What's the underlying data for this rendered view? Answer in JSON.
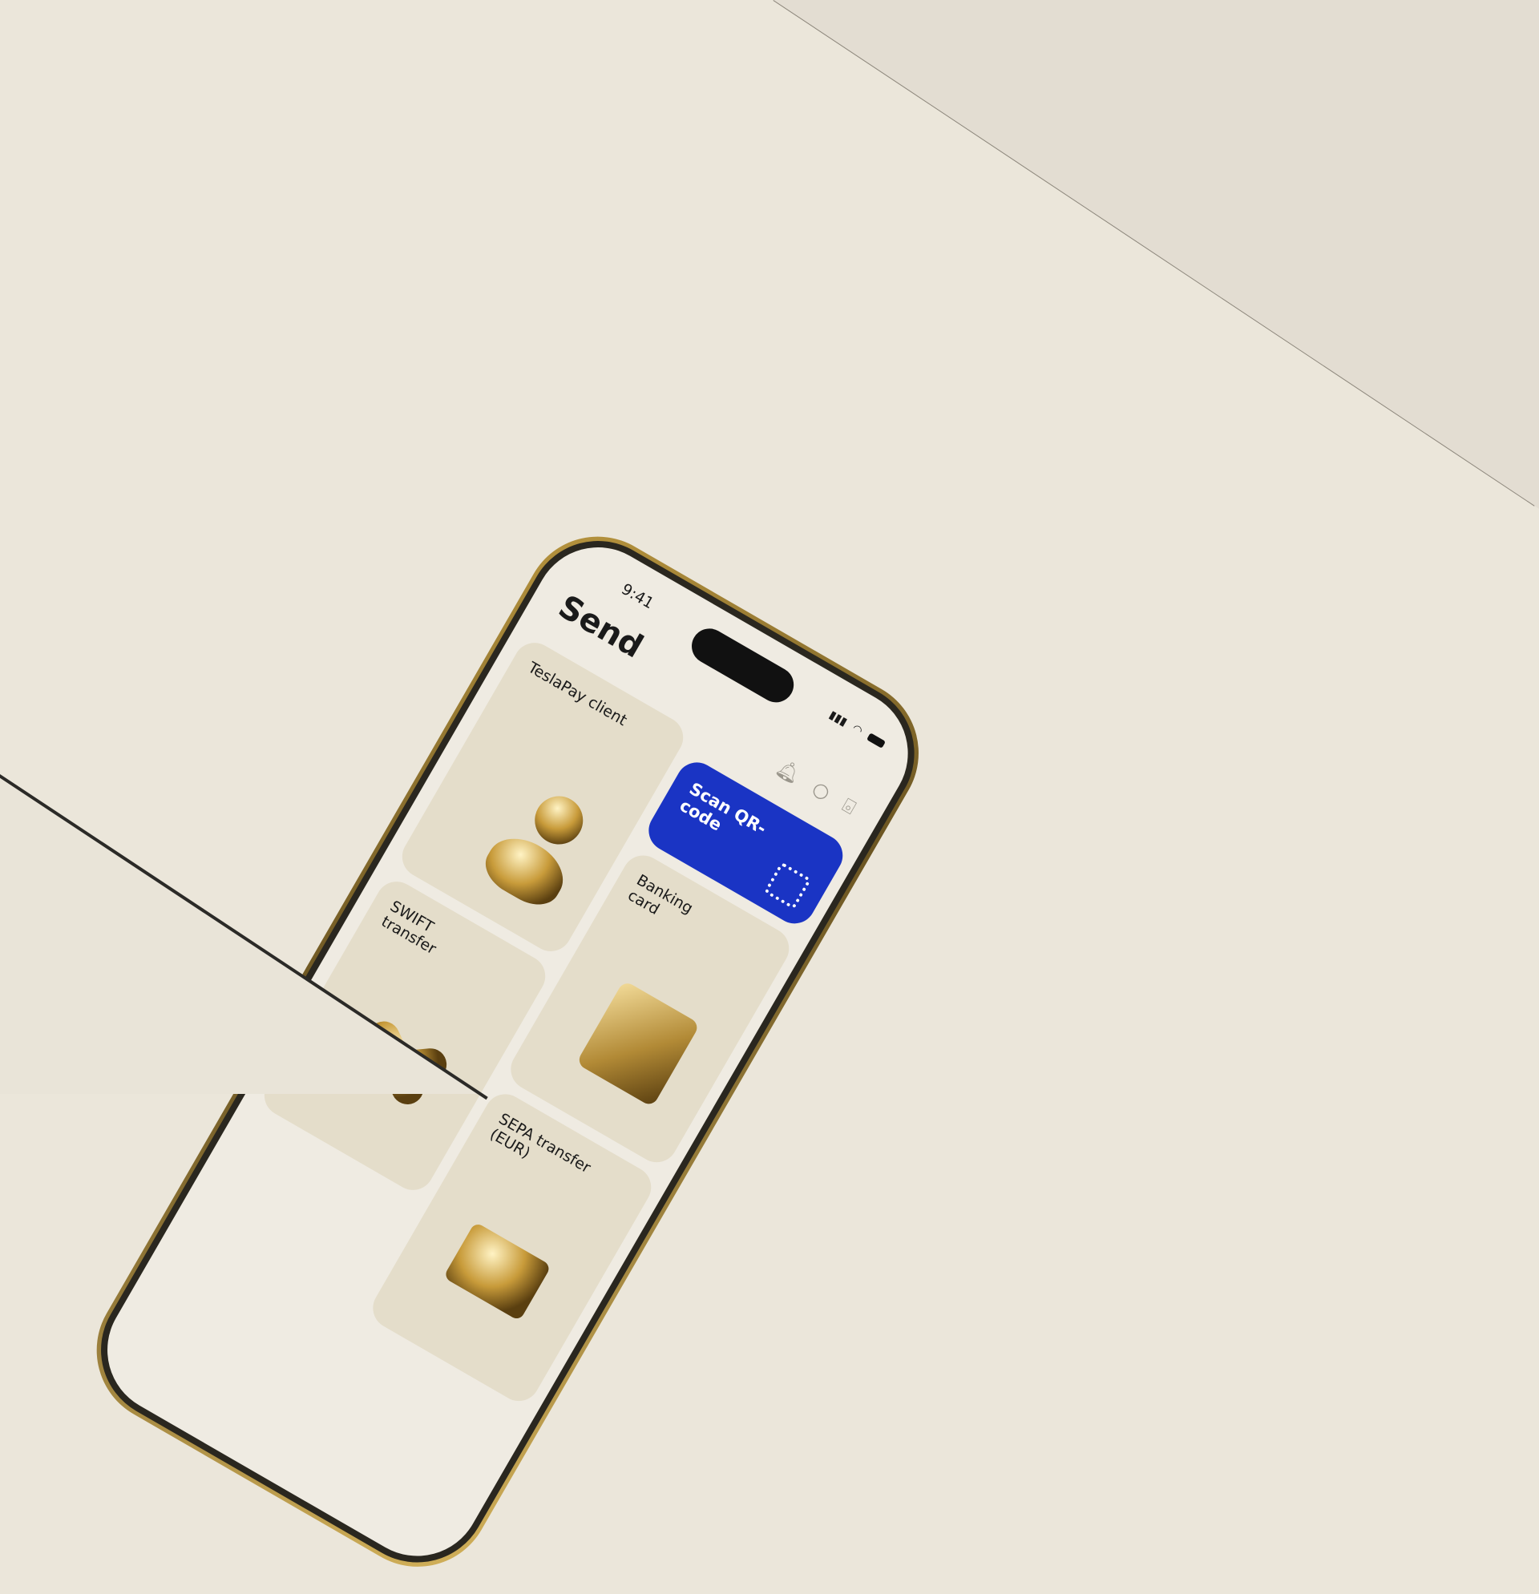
{
  "status_bar": {
    "time": "9:41"
  },
  "header": {
    "title": "Send",
    "icons": [
      "bell-icon",
      "search-icon",
      "scan-icon"
    ]
  },
  "cards": [
    {
      "label": "TeslaPay client"
    },
    {
      "label": "Scan QR-code",
      "accent": "#1a34c4"
    },
    {
      "label": "Banking card"
    },
    {
      "label": "SWIFT transfer"
    },
    {
      "label": "SEPA transfer (EUR)"
    }
  ]
}
